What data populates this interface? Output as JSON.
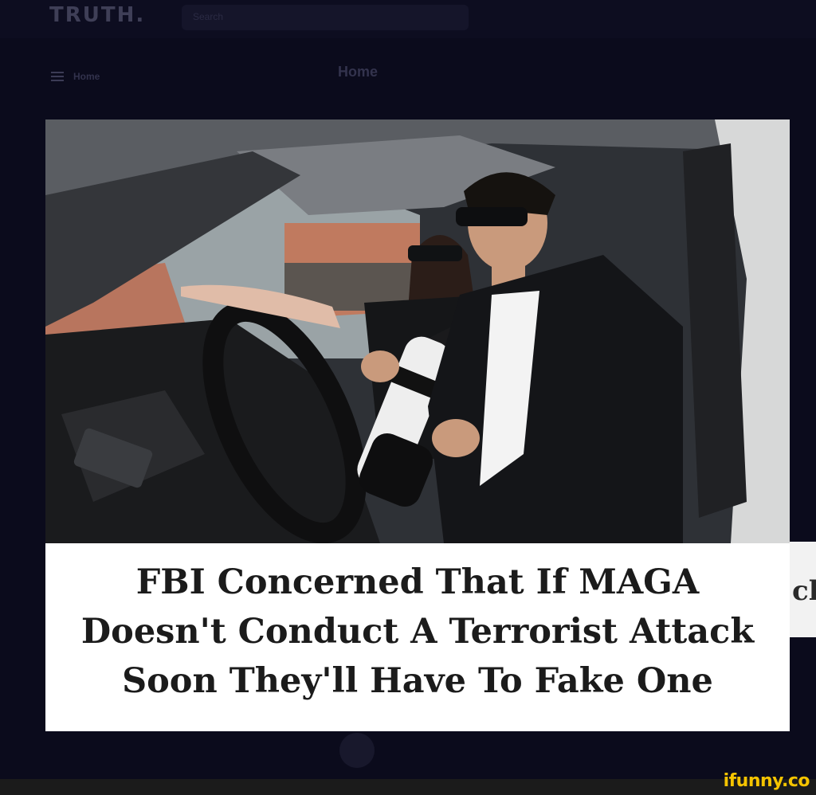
{
  "app": {
    "logo": "TRUTH.",
    "search_placeholder": "Search"
  },
  "nav": {
    "side_home_label": "Home",
    "page_heading": "Home"
  },
  "post": {
    "caption_lines": [
      "FBI Concerned That If MAGA",
      "Doesn't Conduct A Terrorist Attack",
      "Soon They'll Have To Fake One"
    ]
  },
  "background_post": {
    "partial_text": "ck"
  },
  "watermark": {
    "label": "ifunny.co"
  },
  "colors": {
    "page_background": "#0b0b1c",
    "caption_background": "#ffffff",
    "caption_text": "#1b1b1b",
    "watermark": "#f5c400"
  }
}
